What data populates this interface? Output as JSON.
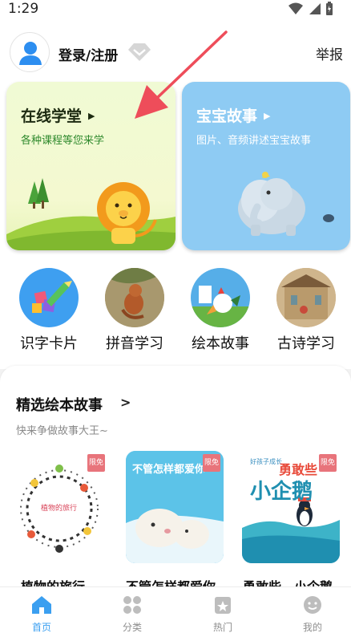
{
  "status_bar": {
    "time": "1:29"
  },
  "header": {
    "login_label": "登录/注册",
    "report_label": "举报"
  },
  "cards": [
    {
      "title": "在线学堂",
      "subtitle": "各种课程等您来学"
    },
    {
      "title": "宝宝故事",
      "subtitle": "图片、音频讲述宝宝故事"
    }
  ],
  "categories": [
    {
      "label": "识字卡片"
    },
    {
      "label": "拼音学习"
    },
    {
      "label": "绘本故事"
    },
    {
      "label": "古诗学习"
    }
  ],
  "section": {
    "title": "精选绘本故事",
    "chevron": ">",
    "subtitle": "快来争做故事大王~"
  },
  "books": [
    {
      "title": "植物的旅行",
      "badge": "限免",
      "cover_text": "植物的旅行"
    },
    {
      "title": "不管怎样都爱你",
      "badge": "限免",
      "cover_text": "不管怎样都爱你"
    },
    {
      "title": "勇敢些，小企鹅",
      "badge": "限免",
      "cover_text_top": "勇敢些",
      "cover_text_main": "小企鹅",
      "cover_series": "好孩子成长"
    }
  ],
  "tabbar": [
    {
      "label": "首页",
      "icon": "home-icon",
      "active": true
    },
    {
      "label": "分类",
      "icon": "grid-icon",
      "active": false
    },
    {
      "label": "热门",
      "icon": "hot-icon",
      "active": false
    },
    {
      "label": "我的",
      "icon": "profile-icon",
      "active": false
    }
  ],
  "colors": {
    "accent": "#3b9ff0",
    "card_left_bg": "#f0fad4",
    "card_right_bg": "#8ecbf3",
    "annotation_arrow": "#ee4d5a"
  }
}
